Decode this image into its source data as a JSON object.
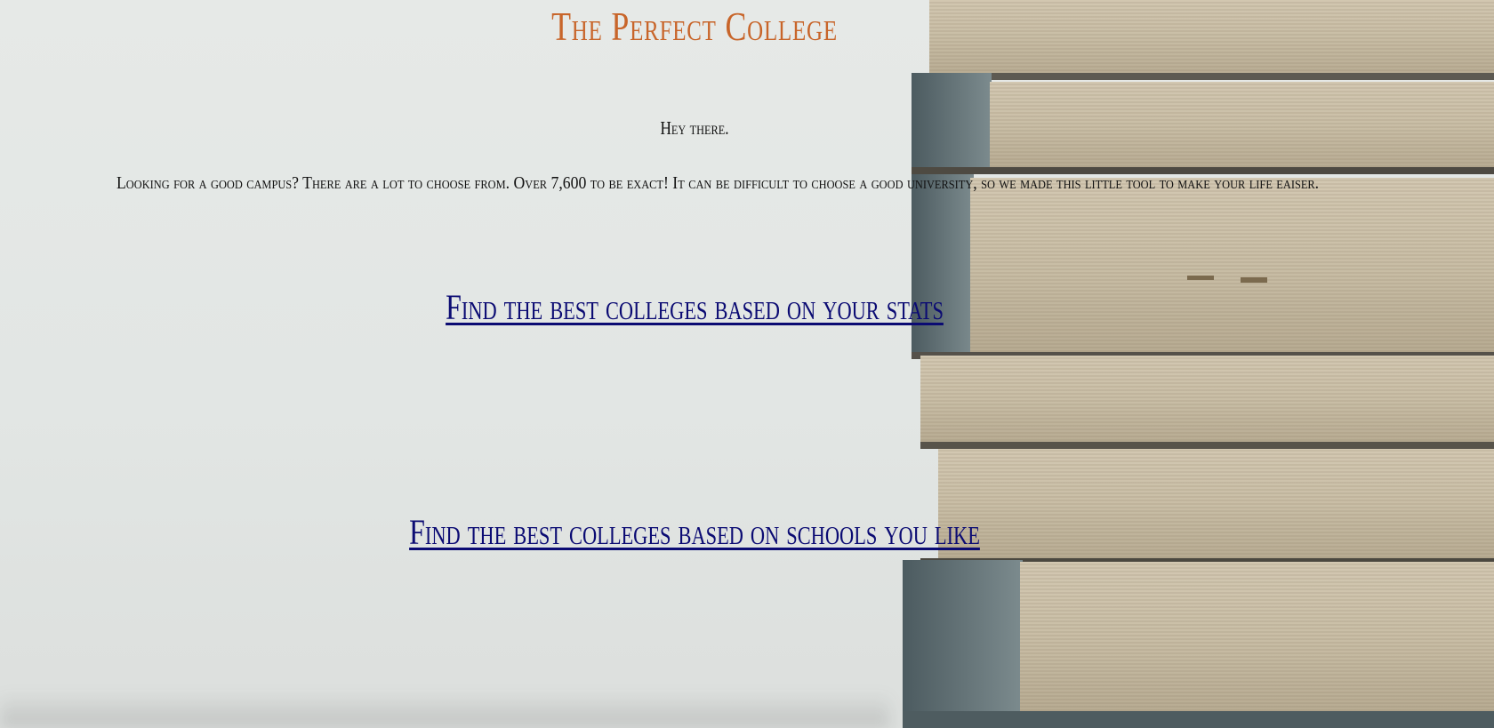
{
  "page": {
    "title": "The Perfect College",
    "greeting": "Hey there.",
    "intro": "Looking for a good campus? There are a lot to choose from. Over 7,600 to be exact! It can be difficult to choose a good university, so we made this little tool to make your life eaiser."
  },
  "links": {
    "stats": "Find the best colleges based on your stats",
    "schools": "Find the best colleges based on schools you like"
  },
  "colors": {
    "title": "#c8652a",
    "text": "#111111",
    "link": "#0b0b73",
    "background": "#e4e7e5"
  },
  "background_image": "stack-of-books-photo"
}
